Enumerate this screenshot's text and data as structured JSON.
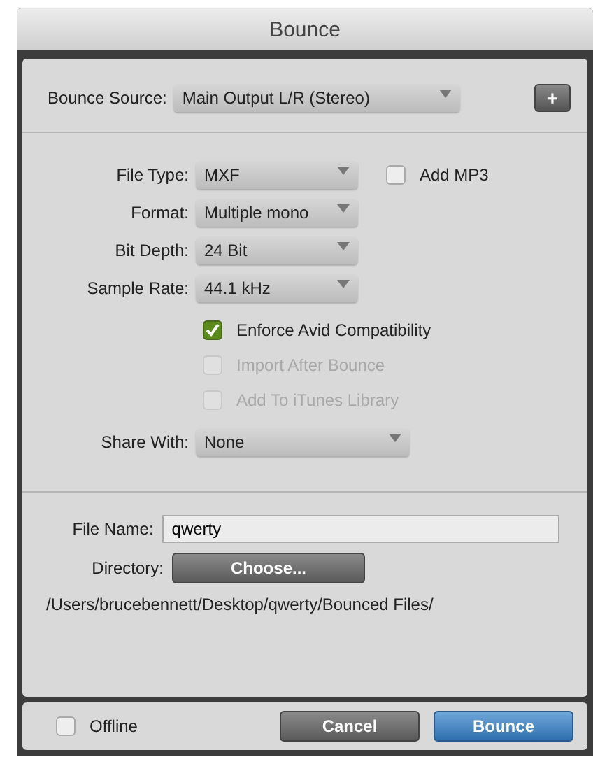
{
  "window": {
    "title": "Bounce"
  },
  "bounce_source": {
    "label": "Bounce Source:",
    "value": "Main Output L/R (Stereo)",
    "add_button": "+"
  },
  "settings": [
    {
      "label": "File Type:",
      "value": "MXF"
    },
    {
      "label": "Format:",
      "value": "Multiple mono"
    },
    {
      "label": "Bit Depth:",
      "value": "24 Bit"
    },
    {
      "label": "Sample Rate:",
      "value": "44.1 kHz"
    }
  ],
  "add_mp3": {
    "label": "Add MP3",
    "checked": false
  },
  "options": [
    {
      "label": "Enforce Avid Compatibility",
      "checked": true,
      "disabled": false
    },
    {
      "label": "Import After Bounce",
      "checked": false,
      "disabled": true
    },
    {
      "label": "Add To iTunes Library",
      "checked": false,
      "disabled": true
    }
  ],
  "share_with": {
    "label": "Share With:",
    "value": "None"
  },
  "file_name": {
    "label": "File Name:",
    "value": "qwerty"
  },
  "directory": {
    "label": "Directory:",
    "button": "Choose..."
  },
  "path": "/Users/brucebennett/Desktop/qwerty/Bounced Files/",
  "footer": {
    "offline": {
      "label": "Offline",
      "checked": false
    },
    "buttons": [
      {
        "label": "Cancel",
        "kind": "secondary"
      },
      {
        "label": "Bounce",
        "kind": "primary"
      }
    ]
  }
}
